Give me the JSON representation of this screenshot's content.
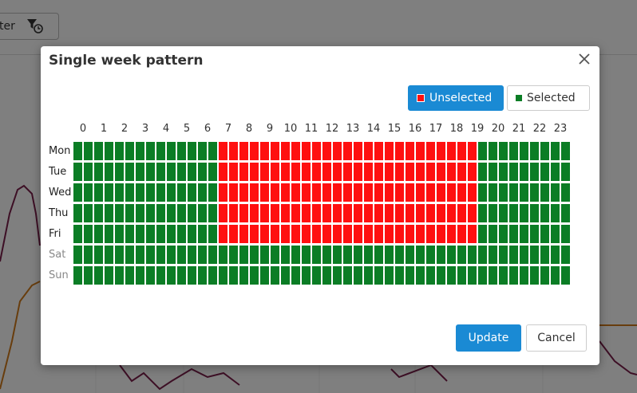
{
  "background": {
    "filter_label": "ter"
  },
  "modal": {
    "title": "Single week pattern",
    "legend": {
      "unselected_label": "Unselected",
      "selected_label": "Selected",
      "unselected_color": "#ff1010",
      "selected_color": "#0b7d25"
    },
    "hours": [
      "0",
      "1",
      "2",
      "3",
      "4",
      "5",
      "6",
      "7",
      "8",
      "9",
      "10",
      "11",
      "12",
      "13",
      "14",
      "15",
      "16",
      "17",
      "18",
      "19",
      "20",
      "21",
      "22",
      "23"
    ],
    "days": [
      {
        "label": "Mon",
        "weekend": false
      },
      {
        "label": "Tue",
        "weekend": false
      },
      {
        "label": "Wed",
        "weekend": false
      },
      {
        "label": "Thu",
        "weekend": false
      },
      {
        "label": "Fri",
        "weekend": false
      },
      {
        "label": "Sat",
        "weekend": true
      },
      {
        "label": "Sun",
        "weekend": true
      }
    ],
    "slots_per_hour": 2,
    "unselected_ranges": [
      {
        "days": [
          "Mon",
          "Tue",
          "Wed",
          "Thu",
          "Fri"
        ],
        "from_slot": 14,
        "to_slot": 38
      }
    ],
    "update_label": "Update",
    "cancel_label": "Cancel"
  }
}
